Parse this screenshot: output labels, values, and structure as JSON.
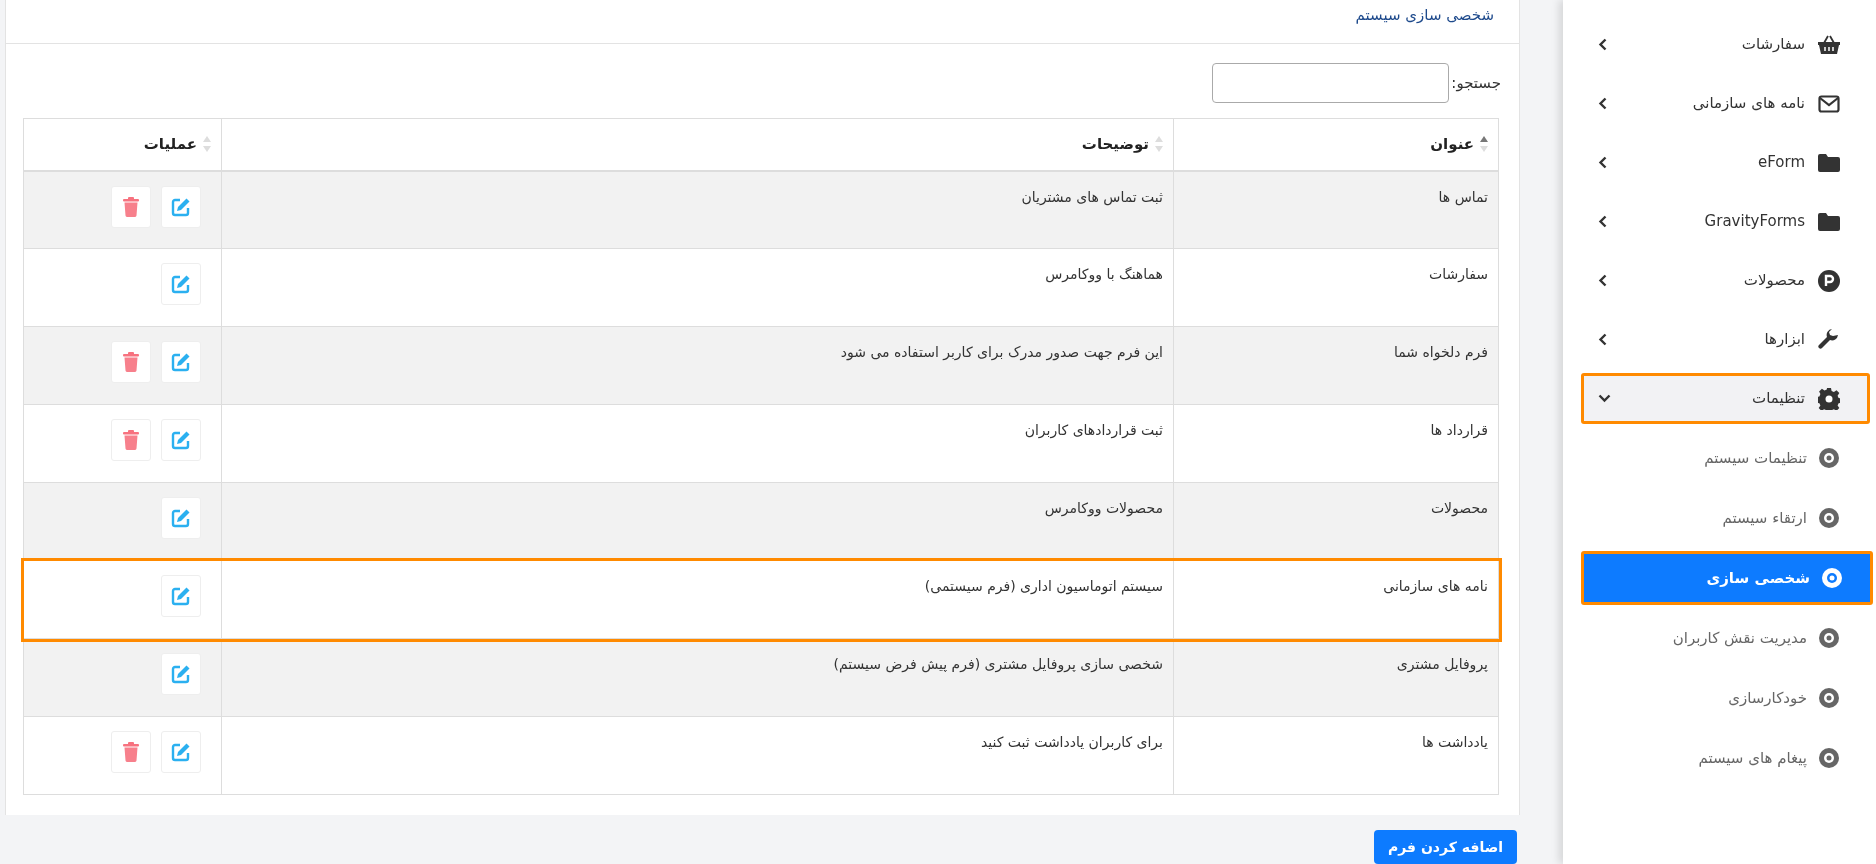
{
  "page_title": "شخصی سازی سیستم",
  "search": {
    "label": "جستجو:"
  },
  "table": {
    "columns": [
      {
        "label": "عنوان",
        "sorted": true
      },
      {
        "label": "توضیحات",
        "sorted": false
      },
      {
        "label": "عملیات",
        "sorted": false
      }
    ],
    "rows": [
      {
        "title": "تماس ها",
        "description": "ثبت تماس های مشتریان",
        "deletable": true,
        "highlighted": false
      },
      {
        "title": "سفارشات",
        "description": "هماهنگ با ووکامرس",
        "deletable": false,
        "highlighted": false
      },
      {
        "title": "فرم دلخواه شما",
        "description": "این فرم جهت صدور مدرک برای کاربر استفاده می شود",
        "deletable": true,
        "highlighted": false
      },
      {
        "title": "قرارداد ها",
        "description": "ثبت قراردادهای کاربران",
        "deletable": true,
        "highlighted": false
      },
      {
        "title": "محصولات",
        "description": "محصولات ووکامرس",
        "deletable": false,
        "highlighted": false
      },
      {
        "title": "نامه های سازمانی",
        "description": "سیستم اتوماسیون اداری (فرم سیستمی)",
        "deletable": false,
        "highlighted": true
      },
      {
        "title": "پروفایل مشتری",
        "description": "شخصی سازی پروفایل مشتری (فرم پیش فرض سیستم)",
        "deletable": false,
        "highlighted": false
      },
      {
        "title": "یادداشت ها",
        "description": "برای کاربران یادداشت ثبت کنید",
        "deletable": true,
        "highlighted": false
      }
    ]
  },
  "add_button": "اضافه کردن فرم",
  "sidebar": {
    "items": [
      {
        "label": "سفارشات",
        "kind": "basket",
        "expanded": false,
        "highlighted": false
      },
      {
        "label": "نامه های سازمانی",
        "kind": "envelope",
        "expanded": false,
        "highlighted": false
      },
      {
        "label": "eForm",
        "kind": "folder",
        "expanded": false,
        "highlighted": false
      },
      {
        "label": "GravityForms",
        "kind": "folder",
        "expanded": false,
        "highlighted": false
      },
      {
        "label": "محصولات",
        "kind": "product",
        "expanded": false,
        "highlighted": false
      },
      {
        "label": "ابزارها",
        "kind": "wrench",
        "expanded": false,
        "highlighted": false
      },
      {
        "label": "تنظیمات",
        "kind": "gear",
        "expanded": true,
        "highlighted": true,
        "children": [
          {
            "label": "تنظیمات سیستم",
            "selected": false,
            "highlighted": false
          },
          {
            "label": "ارتقاء سیستم",
            "selected": false,
            "highlighted": false
          },
          {
            "label": "شخصی سازی",
            "selected": true,
            "highlighted": true
          },
          {
            "label": "مدیریت نقش کاربران",
            "selected": false,
            "highlighted": false
          },
          {
            "label": "خودکارسازی",
            "selected": false,
            "highlighted": false
          },
          {
            "label": "پیغام های سیستم",
            "selected": false,
            "highlighted": false
          }
        ]
      }
    ]
  }
}
